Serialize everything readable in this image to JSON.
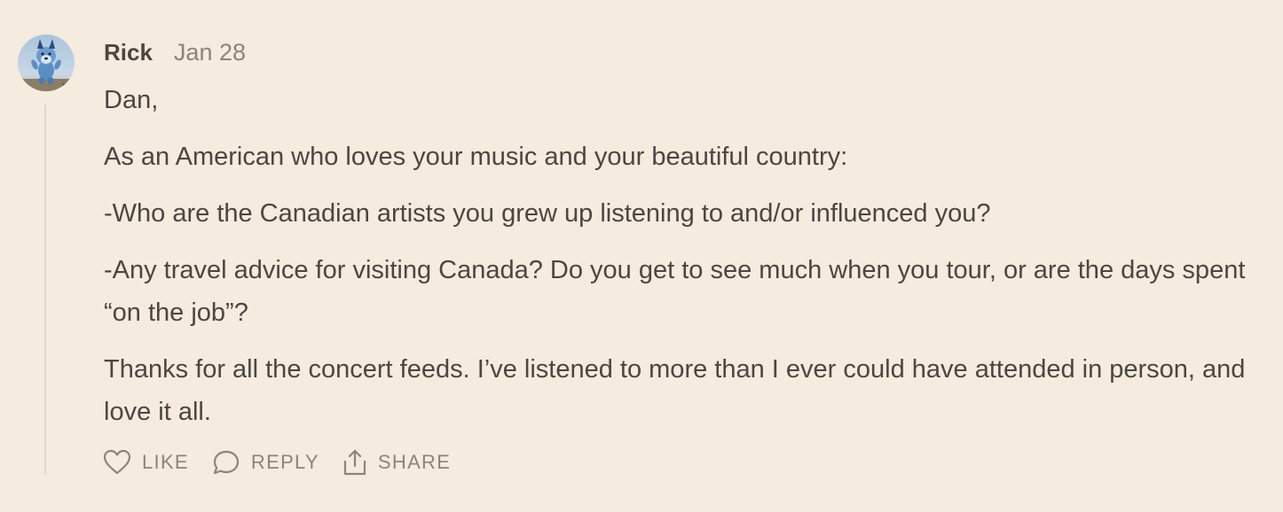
{
  "comment": {
    "author": "Rick",
    "date": "Jan 28",
    "paragraphs": [
      "Dan,",
      "As an American who loves your music and your beautiful country:",
      "-Who are the Canadian artists you grew up listening to and/or influenced you?",
      "-Any travel advice for visiting Canada? Do you get to see much when you tour, or are the days spent “on the job”?",
      "Thanks for all the concert feeds. I’ve listened to more than I ever could have attended in person, and love it all."
    ],
    "actions": {
      "like_label": "LIKE",
      "reply_label": "REPLY",
      "share_label": "SHARE"
    }
  },
  "icons": {
    "like": "heart-icon",
    "reply": "speech-bubble-icon",
    "share": "share-upload-icon"
  },
  "colors": {
    "background": "#f5ebdf",
    "text": "#4d4640",
    "muted": "#8c847c",
    "thread_line": "#e0d6cb"
  }
}
